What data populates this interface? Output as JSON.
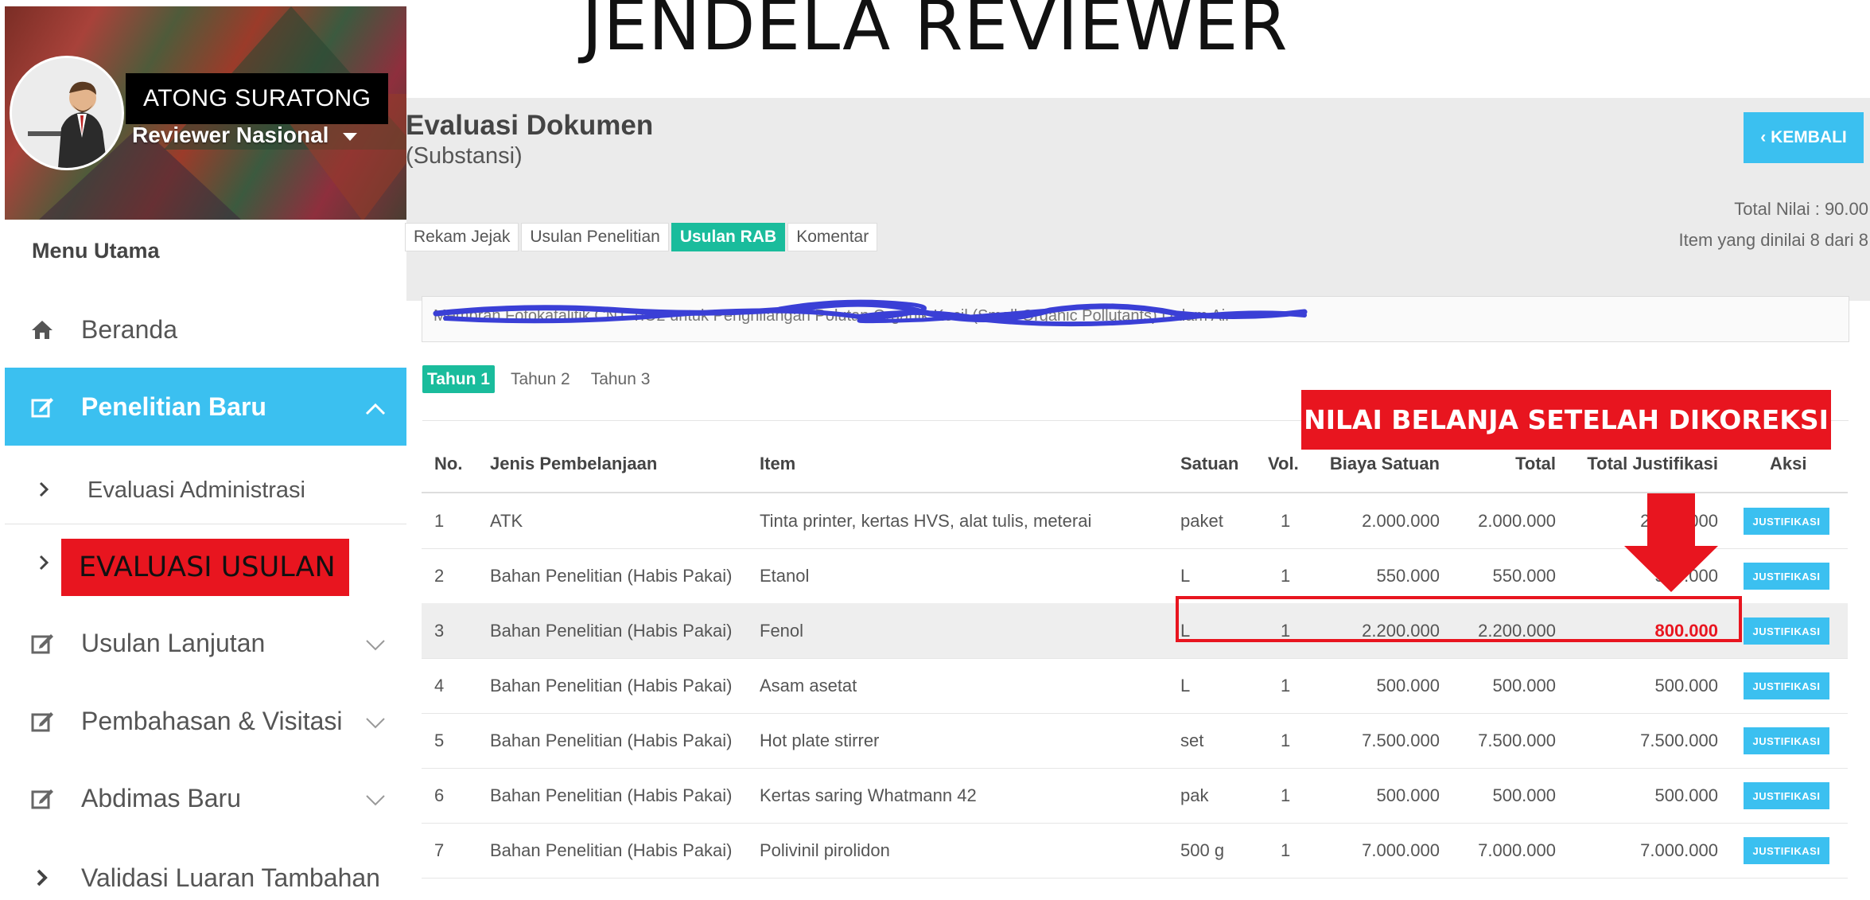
{
  "slide_title": "JENDELA REVIEWER",
  "profile": {
    "name": "ATONG SURATONG",
    "role": "Reviewer Nasional"
  },
  "sidebar": {
    "heading": "Menu Utama",
    "items": [
      {
        "label": "Beranda",
        "icon": "home-icon"
      },
      {
        "label": "Penelitian Baru",
        "icon": "edit-icon",
        "active": true
      },
      {
        "label": "Evaluasi Administrasi",
        "icon": "chevron-right-icon"
      },
      {
        "label": "Usulan Lanjutan",
        "icon": "edit-icon"
      },
      {
        "label": "Pembahasan & Visitasi",
        "icon": "edit-icon"
      },
      {
        "label": "Abdimas Baru",
        "icon": "edit-icon"
      },
      {
        "label": "Validasi Luaran Tambahan",
        "icon": "chevron-right-icon"
      }
    ]
  },
  "annotation_evaluasi": "EVALUASI USULAN",
  "header": {
    "title": "Evaluasi Dokumen",
    "subtitle": "(Substansi)",
    "back_label": "‹ KEMBALI",
    "total_nilai": "Total Nilai : 90.00",
    "item_dinilai": "Item yang dinilai 8  dari 8"
  },
  "tabs": [
    "Rekam Jejak",
    "Usulan Penelitian",
    "Usulan RAB",
    "Komentar"
  ],
  "active_tab": "Usulan RAB",
  "proposal_title": "Membran Fotokatalitik CNT-TiO2 untuk Penghilangan Polutan Organik Kecil (Small Organic Pollutants) Dalam Air",
  "year_tabs": [
    "Tahun 1",
    "Tahun 2",
    "Tahun 3"
  ],
  "annotation_callout": "NILAI BELANJA SETELAH DIKOREKSI",
  "table": {
    "headers": [
      "No.",
      "Jenis Pembelanjaan",
      "Item",
      "Satuan",
      "Vol.",
      "Biaya Satuan",
      "Total",
      "Total Justifikasi",
      "Aksi"
    ],
    "button_label": "JUSTIFIKASI",
    "rows": [
      {
        "no": "1",
        "jenis": "ATK",
        "item": "Tinta printer, kertas HVS, alat tulis, meterai",
        "satuan": "paket",
        "vol": "1",
        "biaya": "2.000.000",
        "total": "2.000.000",
        "justifikasi": "2.000.000"
      },
      {
        "no": "2",
        "jenis": "Bahan Penelitian (Habis Pakai)",
        "item": "Etanol",
        "satuan": "L",
        "vol": "1",
        "biaya": "550.000",
        "total": "550.000",
        "justifikasi": "550.000"
      },
      {
        "no": "3",
        "jenis": "Bahan Penelitian (Habis Pakai)",
        "item": "Fenol",
        "satuan": "L",
        "vol": "1",
        "biaya": "2.200.000",
        "total": "2.200.000",
        "justifikasi": "800.000"
      },
      {
        "no": "4",
        "jenis": "Bahan Penelitian (Habis Pakai)",
        "item": "Asam asetat",
        "satuan": "L",
        "vol": "1",
        "biaya": "500.000",
        "total": "500.000",
        "justifikasi": "500.000"
      },
      {
        "no": "5",
        "jenis": "Bahan Penelitian (Habis Pakai)",
        "item": "Hot plate stirrer",
        "satuan": "set",
        "vol": "1",
        "biaya": "7.500.000",
        "total": "7.500.000",
        "justifikasi": "7.500.000"
      },
      {
        "no": "6",
        "jenis": "Bahan Penelitian (Habis Pakai)",
        "item": "Kertas saring Whatmann 42",
        "satuan": "pak",
        "vol": "1",
        "biaya": "500.000",
        "total": "500.000",
        "justifikasi": "500.000"
      },
      {
        "no": "7",
        "jenis": "Bahan Penelitian (Habis Pakai)",
        "item": "Polivinil pirolidon",
        "satuan": "500 g",
        "vol": "1",
        "biaya": "7.000.000",
        "total": "7.000.000",
        "justifikasi": "7.000.000"
      }
    ]
  },
  "colors": {
    "accent": "#3bc0f0",
    "tab_active": "#1abc9c",
    "annotation_red": "#e8151f",
    "corrected_value": "#e8151f"
  }
}
